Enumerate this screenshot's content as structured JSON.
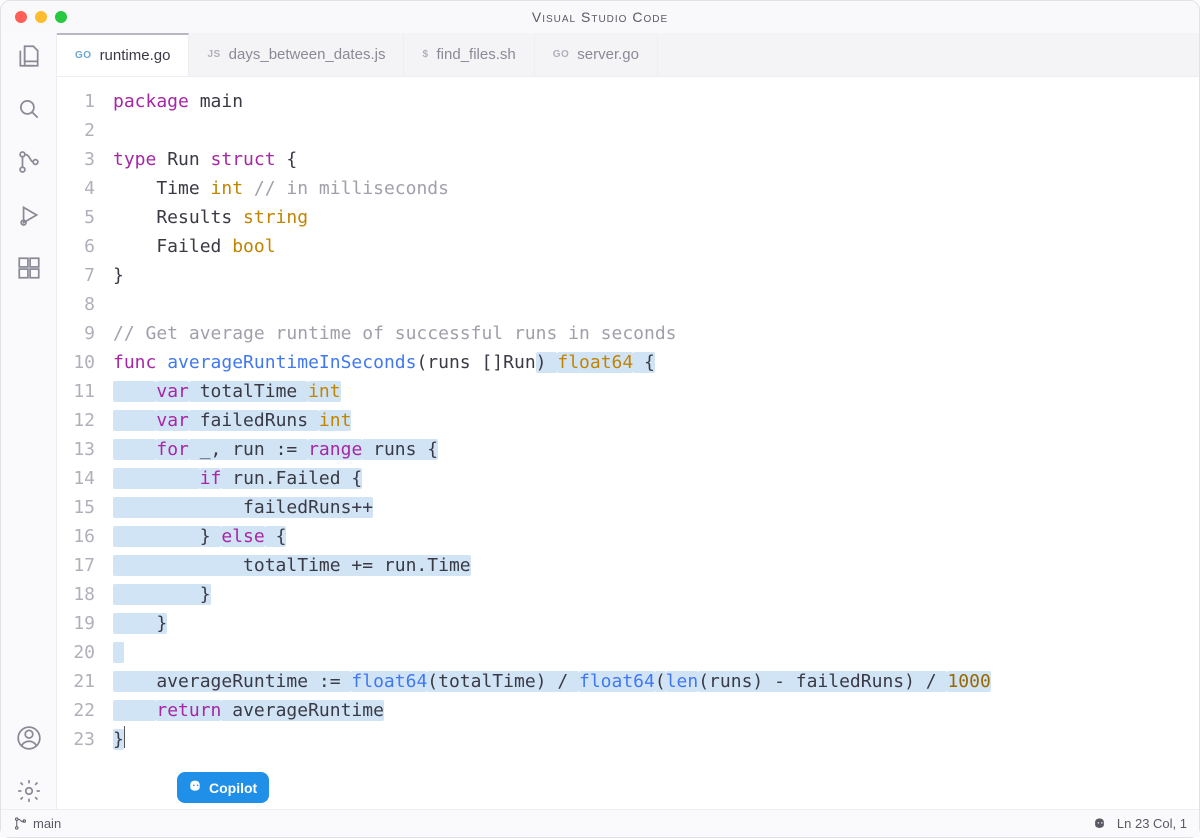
{
  "window": {
    "title": "Visual Studio Code"
  },
  "tabs": [
    {
      "lang": "GO",
      "label": "runtime.go",
      "active": true
    },
    {
      "lang": "JS",
      "label": "days_between_dates.js",
      "active": false
    },
    {
      "lang": "$",
      "label": "find_files.sh",
      "active": false
    },
    {
      "lang": "GO",
      "label": "server.go",
      "active": false
    }
  ],
  "code": {
    "lines": [
      {
        "n": 1,
        "t": [
          [
            "kw",
            "package"
          ],
          [
            "",
            " main"
          ]
        ]
      },
      {
        "n": 2,
        "t": [
          [
            "",
            ""
          ]
        ]
      },
      {
        "n": 3,
        "t": [
          [
            "kw",
            "type"
          ],
          [
            "",
            " Run "
          ],
          [
            "kw",
            "struct"
          ],
          [
            "",
            " {"
          ]
        ]
      },
      {
        "n": 4,
        "t": [
          [
            "",
            "    Time "
          ],
          [
            "typ",
            "int"
          ],
          [
            "",
            " "
          ],
          [
            "cmt",
            "// in milliseconds"
          ]
        ]
      },
      {
        "n": 5,
        "t": [
          [
            "",
            "    Results "
          ],
          [
            "typ",
            "string"
          ]
        ]
      },
      {
        "n": 6,
        "t": [
          [
            "",
            "    Failed "
          ],
          [
            "typ",
            "bool"
          ]
        ]
      },
      {
        "n": 7,
        "t": [
          [
            "",
            "}"
          ]
        ]
      },
      {
        "n": 8,
        "t": [
          [
            "",
            ""
          ]
        ]
      },
      {
        "n": 9,
        "t": [
          [
            "cmt",
            "// Get average runtime of successful runs in seconds"
          ]
        ]
      },
      {
        "n": 10,
        "t": [
          [
            "kw",
            "func"
          ],
          [
            "",
            " "
          ],
          [
            "fn",
            "averageRuntimeInSeconds"
          ],
          [
            "",
            "(runs []Run) "
          ],
          [
            "typ",
            "float64"
          ],
          [
            "",
            " {"
          ]
        ],
        "selFrom": 39
      },
      {
        "n": 11,
        "sel": true,
        "t": [
          [
            "",
            "    "
          ],
          [
            "kw",
            "var"
          ],
          [
            "",
            " totalTime "
          ],
          [
            "typ",
            "int"
          ]
        ]
      },
      {
        "n": 12,
        "sel": true,
        "t": [
          [
            "",
            "    "
          ],
          [
            "kw",
            "var"
          ],
          [
            "",
            " failedRuns "
          ],
          [
            "typ",
            "int"
          ]
        ]
      },
      {
        "n": 13,
        "sel": true,
        "t": [
          [
            "",
            "    "
          ],
          [
            "kw",
            "for"
          ],
          [
            "",
            " _, run := "
          ],
          [
            "kw",
            "range"
          ],
          [
            "",
            " runs {"
          ]
        ]
      },
      {
        "n": 14,
        "sel": true,
        "t": [
          [
            "",
            "        "
          ],
          [
            "kw",
            "if"
          ],
          [
            "",
            " run.Failed {"
          ]
        ]
      },
      {
        "n": 15,
        "sel": true,
        "t": [
          [
            "",
            "            failedRuns++"
          ]
        ]
      },
      {
        "n": 16,
        "sel": true,
        "t": [
          [
            "",
            "        } "
          ],
          [
            "kw",
            "else"
          ],
          [
            "",
            " {"
          ]
        ]
      },
      {
        "n": 17,
        "sel": true,
        "t": [
          [
            "",
            "            totalTime += run.Time"
          ]
        ]
      },
      {
        "n": 18,
        "sel": true,
        "t": [
          [
            "",
            "        }"
          ]
        ]
      },
      {
        "n": 19,
        "sel": true,
        "t": [
          [
            "",
            "    }"
          ]
        ]
      },
      {
        "n": 20,
        "sel": true,
        "t": [
          [
            "",
            ""
          ]
        ]
      },
      {
        "n": 21,
        "sel": true,
        "t": [
          [
            "",
            "    averageRuntime := "
          ],
          [
            "fn",
            "float64"
          ],
          [
            "",
            "(totalTime) / "
          ],
          [
            "fn",
            "float64"
          ],
          [
            "",
            "("
          ],
          [
            "fn",
            "len"
          ],
          [
            "",
            "(runs) - failedRuns) / "
          ],
          [
            "num",
            "1000"
          ]
        ]
      },
      {
        "n": 22,
        "sel": true,
        "t": [
          [
            "",
            "    "
          ],
          [
            "kw",
            "return"
          ],
          [
            "",
            " averageRuntime"
          ]
        ]
      },
      {
        "n": 23,
        "sel": true,
        "cursor": true,
        "t": [
          [
            "",
            "}"
          ]
        ]
      }
    ]
  },
  "copilot": {
    "label": "Copilot"
  },
  "status": {
    "branch": "main",
    "position": "Ln 23 Col, 1"
  }
}
